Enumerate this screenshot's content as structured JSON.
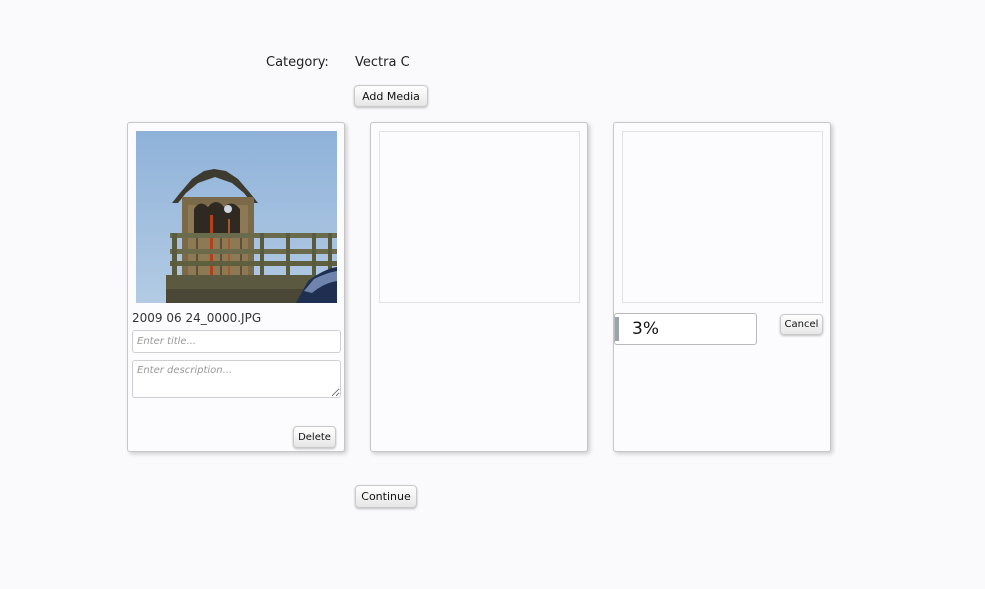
{
  "form": {
    "category_label": "Category:",
    "category_value": "Vectra C",
    "add_media_label": "Add Media",
    "continue_label": "Continue"
  },
  "uploads": [
    {
      "filename": "2009 06 24_0000.JPG",
      "title_placeholder": "Enter title...",
      "description_placeholder": "Enter description...",
      "delete_label": "Delete"
    },
    {
      "status": "empty"
    },
    {
      "progress_text": "3%",
      "progress": 0.03,
      "cancel_label": "Cancel"
    }
  ]
}
